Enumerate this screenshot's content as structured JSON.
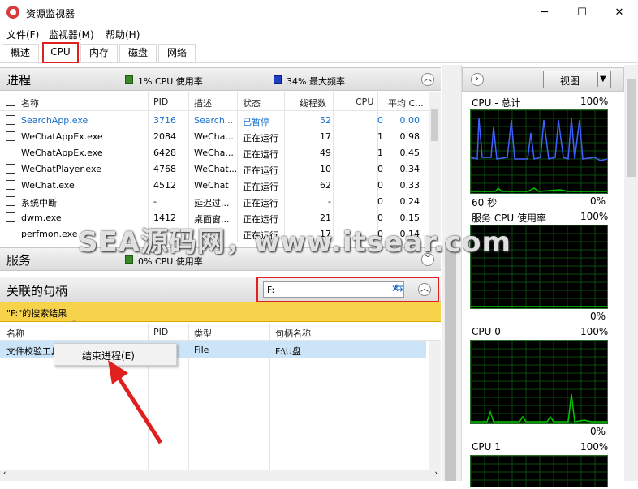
{
  "window": {
    "title": "资源监视器",
    "minimize": "─",
    "maximize": "☐",
    "close": "✕"
  },
  "menu": [
    "文件(F)",
    "监视器(M)",
    "帮助(H)"
  ],
  "tabs": [
    "概述",
    "CPU",
    "内存",
    "磁盘",
    "网络"
  ],
  "process": {
    "title": "进程",
    "cpu_usage": "1% CPU 使用率",
    "max_freq": "34% 最大频率",
    "columns": [
      "名称",
      "PID",
      "描述",
      "状态",
      "线程数",
      "CPU",
      "平均 C..."
    ],
    "rows": [
      [
        "SearchApp.exe",
        "3716",
        "Search...",
        "已暂停",
        "52",
        "0",
        "0.00"
      ],
      [
        "WeChatAppEx.exe",
        "2084",
        "WeCha...",
        "正在运行",
        "17",
        "1",
        "0.98"
      ],
      [
        "WeChatAppEx.exe",
        "6428",
        "WeCha...",
        "正在运行",
        "49",
        "1",
        "0.45"
      ],
      [
        "WeChatPlayer.exe",
        "4768",
        "WeChat...",
        "正在运行",
        "10",
        "0",
        "0.34"
      ],
      [
        "WeChat.exe",
        "4512",
        "WeChat",
        "正在运行",
        "62",
        "0",
        "0.33"
      ],
      [
        "系统中断",
        "-",
        "延迟过...",
        "正在运行",
        "-",
        "0",
        "0.24"
      ],
      [
        "dwm.exe",
        "1412",
        "桌面窗...",
        "正在运行",
        "21",
        "0",
        "0.15"
      ],
      [
        "perfmon.exe",
        "",
        "",
        "正在运行",
        "17",
        "0",
        "0.14"
      ]
    ]
  },
  "services": {
    "title": "服务",
    "cpu_usage": "0% CPU 使用率"
  },
  "handles": {
    "title": "关联的句柄",
    "search_value": "F:",
    "result_banner": "\"F:\"的搜索结果",
    "columns": [
      "名称",
      "PID",
      "类型",
      "句柄名称"
    ],
    "row": {
      "name": "文件校验工具",
      "pid": "",
      "type": "File",
      "handle": "F:\\U盘"
    },
    "context_menu": "结束进程(E)"
  },
  "right": {
    "view_button": "视图",
    "graphs": [
      {
        "title": "CPU - 总计",
        "max": "100%",
        "foot_left": "60 秒",
        "foot_right": "0%"
      },
      {
        "title": "服务 CPU 使用率",
        "max": "100%",
        "foot_right": "0%"
      },
      {
        "title": "CPU 0",
        "max": "100%",
        "foot_right": "0%"
      },
      {
        "title": "CPU 1",
        "max": "100%"
      }
    ]
  },
  "watermark": "SEA源码网，www.itsear.com",
  "colors": {
    "highlight_red": "#e0201f",
    "banner_yellow": "#f7d34c",
    "graph_green": "#00c800",
    "graph_blue": "#4060ff",
    "link_blue": "#1a6fc8"
  }
}
